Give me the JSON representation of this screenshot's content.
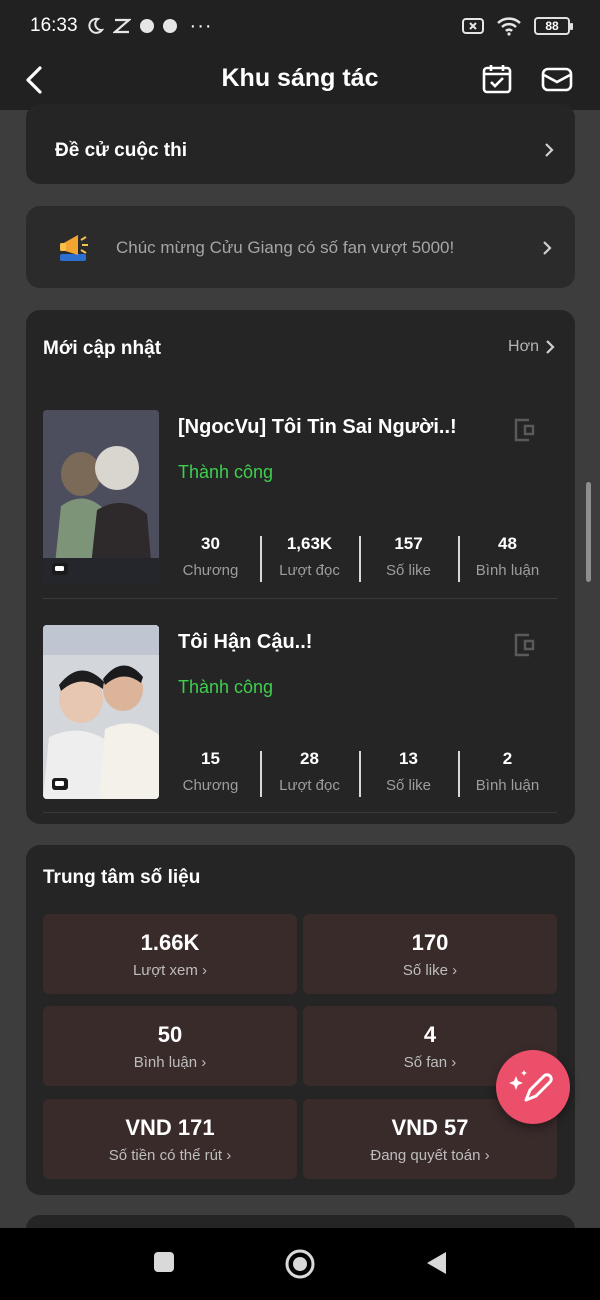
{
  "status_bar": {
    "time": "16:33",
    "more": "···",
    "battery": "88"
  },
  "header": {
    "title": "Khu sáng tác"
  },
  "contest": {
    "label": "Đề cử cuộc thi"
  },
  "announcement": {
    "text": "Chúc mừng Cửu Giang có số fan vượt 5000!"
  },
  "updates": {
    "title": "Mới cập nhật",
    "more": "Hơn",
    "books": [
      {
        "title": "[NgocVu] Tôi Tin Sai Người..!",
        "status": "Thành công",
        "stats": [
          {
            "value": "30",
            "label": "Chương"
          },
          {
            "value": "1,63K",
            "label": "Lượt đọc"
          },
          {
            "value": "157",
            "label": "Số like"
          },
          {
            "value": "48",
            "label": "Bình luận"
          }
        ]
      },
      {
        "title": "Tôi Hận Cậu..!",
        "status": "Thành công",
        "stats": [
          {
            "value": "15",
            "label": "Chương"
          },
          {
            "value": "28",
            "label": "Lượt đọc"
          },
          {
            "value": "13",
            "label": "Số like"
          },
          {
            "value": "2",
            "label": "Bình luận"
          }
        ]
      }
    ]
  },
  "data_center": {
    "title": "Trung tâm số liệu",
    "metrics": [
      {
        "value": "1.66K",
        "label": "Lượt xem"
      },
      {
        "value": "170",
        "label": "Số like"
      },
      {
        "value": "50",
        "label": "Bình luận"
      },
      {
        "value": "4",
        "label": "Số fan"
      },
      {
        "value": "VND 171",
        "label": "Số tiền có thể rút"
      },
      {
        "value": "VND 57",
        "label": "Đang quyết toán"
      }
    ]
  },
  "colors": {
    "success": "#3fcf4f",
    "fab": "#ec4f69",
    "metric_bg": "#3a2b2b"
  }
}
